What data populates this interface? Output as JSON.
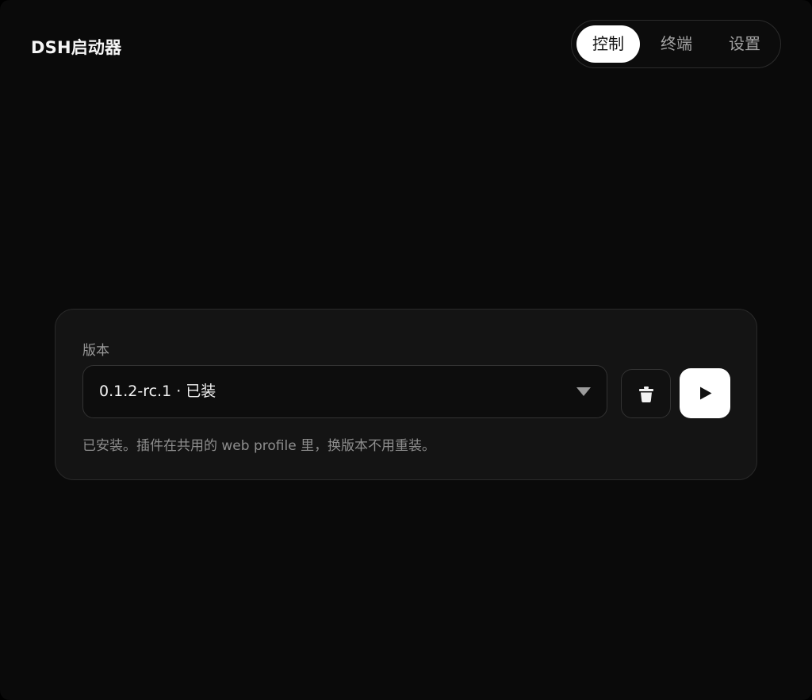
{
  "app": {
    "title": "DSH启动器"
  },
  "tabs": [
    {
      "label": "控制",
      "active": true
    },
    {
      "label": "终端",
      "active": false
    },
    {
      "label": "设置",
      "active": false
    }
  ],
  "version_card": {
    "label": "版本",
    "selected_version": "0.1.2-rc.1 · 已装",
    "hint": "已安装。插件在共用的 web profile 里，换版本不用重装。",
    "delete_icon": "trash-icon",
    "launch_icon": "play-icon"
  },
  "colors": {
    "background": "#0a0a0a",
    "card": "#141414",
    "accent": "#ffffff",
    "muted_text": "#9a9a9a"
  }
}
